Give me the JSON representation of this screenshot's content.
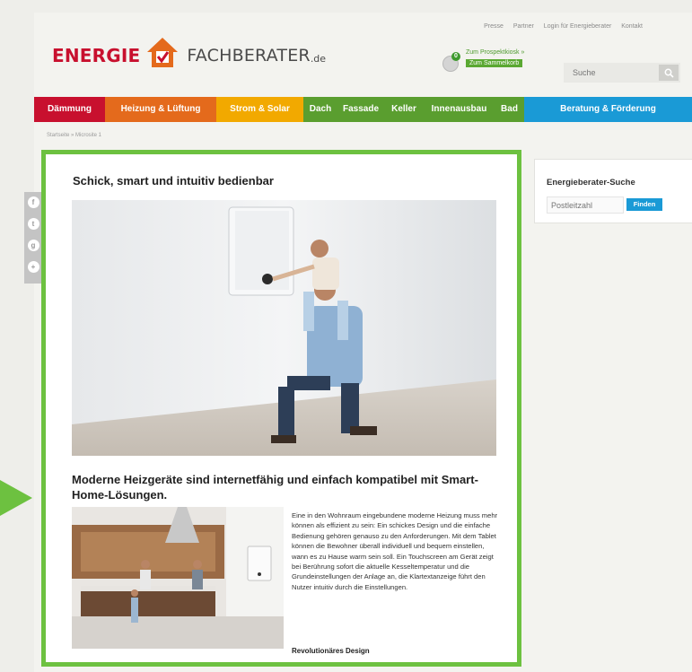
{
  "header": {
    "links": [
      "Presse",
      "Partner",
      "Login für Energieberater",
      "Kontakt"
    ],
    "logo": {
      "word1": "ENERGIE",
      "word2": "FACHBERATER",
      "suffix": ".de"
    },
    "catalog": {
      "count": "0",
      "line1": "Zum Prospektkiosk »",
      "line2": "Zum Sammelkorb"
    },
    "search": {
      "placeholder": "Suche"
    }
  },
  "nav": {
    "items": [
      "Dämmung",
      "Heizung & Lüftung",
      "Strom & Solar",
      "Dach",
      "Fassade",
      "Keller",
      "Innenausbau",
      "Bad",
      "Beratung & Förderung"
    ]
  },
  "breadcrumb": "Startseite » Microsite 1",
  "social": [
    "facebook-icon",
    "twitter-icon",
    "googleplus-icon",
    "share-icon"
  ],
  "article": {
    "title": "Schick, smart und intuitiv bedienbar",
    "subtitle": "Moderne Heizgeräte sind internetfähig und einfach kompatibel mit Smart-Home-Lösungen.",
    "body": "Eine in den Wohnraum eingebundene moderne Heizung muss mehr können als effizient zu sein: Ein schickes Design und die einfache Bedienung gehören genauso zu den Anforderungen. Mit dem Tablet können die Bewohner überall individuell und bequem einstellen, wann es zu Hause warm sein soll. Ein Touchscreen am Gerät zeigt bei Berührung sofort die aktuelle Kesseltemperatur und die Grundeinstellungen der Anlage an, die Klartextanzeige führt den Nutzer intuitiv durch die Einstellungen.",
    "subheading": "Revolutionäres Design"
  },
  "sidebar": {
    "title": "Energieberater-Suche",
    "zip_placeholder": "Postleitzahl",
    "button": "Finden"
  },
  "colors": {
    "highlight": "#6dc140",
    "brand_red": "#c8102e",
    "nav_orange": "#e46a1c",
    "nav_yellow": "#f2a900",
    "nav_green": "#5a9e2f",
    "nav_blue": "#1a9ad6"
  }
}
